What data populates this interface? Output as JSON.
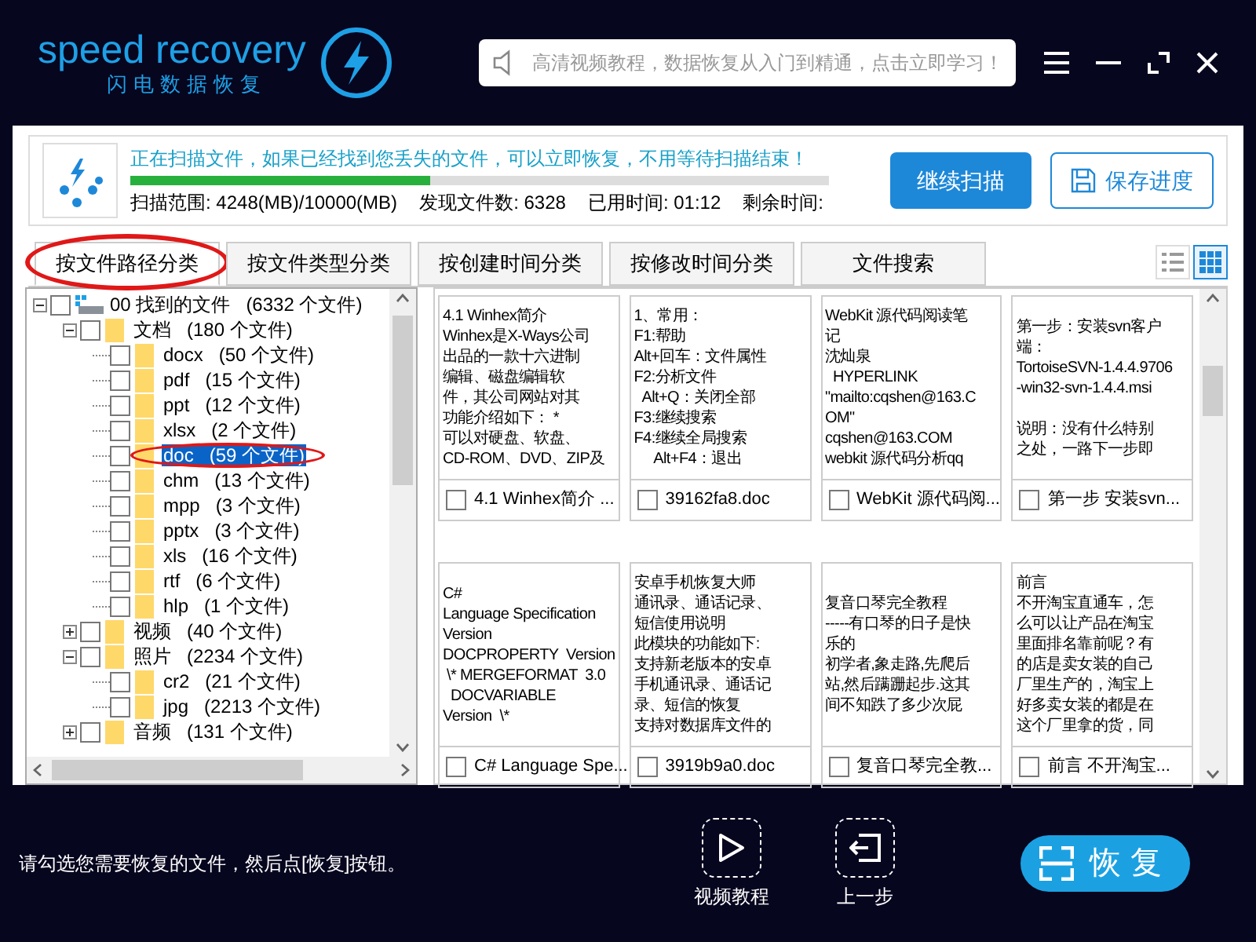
{
  "header": {
    "logo_text": "speed recovery",
    "logo_subtitle": "闪电数据恢复",
    "notice": "高清视频教程，数据恢复从入门到精通，点击立即学习！"
  },
  "scan": {
    "message": "正在扫描文件，如果已经找到您丢失的文件，可以立即恢复，不用等待扫描结束！",
    "level": 0.43,
    "range": "扫描范围: 4248(MB)/10000(MB)",
    "found": "发现文件数: 6328",
    "elapsed": "已用时间: 01:12",
    "remaining": "剩余时间:",
    "buttons": [
      {
        "label": "继续扫描",
        "kind": "primary"
      },
      {
        "label": "保存进度",
        "kind": "save"
      }
    ]
  },
  "tabs": [
    {
      "label": "按文件路径分类",
      "selected": true,
      "circled": true
    },
    {
      "label": "按文件类型分类",
      "selected": false,
      "circled": false
    },
    {
      "label": "按创建时间分类",
      "selected": false,
      "circled": false
    },
    {
      "label": "按修改时间分类",
      "selected": false,
      "circled": false
    },
    {
      "label": "文件搜索",
      "selected": false,
      "circled": false
    }
  ],
  "view_modes": [
    {
      "kind": "list",
      "selected": false
    },
    {
      "kind": "grid",
      "selected": true
    }
  ],
  "tree": [
    {
      "name": "00 找到的文件",
      "count": "(6332 个文件)",
      "kind": "drive",
      "expanded": true,
      "checked": false,
      "selected": false,
      "circled": false,
      "children": [
        {
          "name": "文档",
          "count": "(180 个文件)",
          "expanded": true,
          "checked": false,
          "selected": false,
          "circled": false,
          "children": [
            {
              "name": "docx",
              "count": "(50 个文件)",
              "checked": false,
              "selected": false,
              "circled": false
            },
            {
              "name": "pdf",
              "count": "(15 个文件)",
              "checked": false,
              "selected": false,
              "circled": false
            },
            {
              "name": "ppt",
              "count": "(12 个文件)",
              "checked": false,
              "selected": false,
              "circled": false
            },
            {
              "name": "xlsx",
              "count": "(2 个文件)",
              "checked": false,
              "selected": false,
              "circled": false
            },
            {
              "name": "doc",
              "count": "(59 个文件)",
              "checked": false,
              "selected": true,
              "circled": true
            },
            {
              "name": "chm",
              "count": "(13 个文件)",
              "checked": false,
              "selected": false,
              "circled": false
            },
            {
              "name": "mpp",
              "count": "(3 个文件)",
              "checked": false,
              "selected": false,
              "circled": false
            },
            {
              "name": "pptx",
              "count": "(3 个文件)",
              "checked": false,
              "selected": false,
              "circled": false
            },
            {
              "name": "xls",
              "count": "(16 个文件)",
              "checked": false,
              "selected": false,
              "circled": false
            },
            {
              "name": "rtf",
              "count": "(6 个文件)",
              "checked": false,
              "selected": false,
              "circled": false
            },
            {
              "name": "hlp",
              "count": "(1 个文件)",
              "checked": false,
              "selected": false,
              "circled": false
            }
          ]
        },
        {
          "name": "视频",
          "count": "(40 个文件)",
          "expanded": false,
          "checked": false,
          "selected": false,
          "circled": false
        },
        {
          "name": "照片",
          "count": "(2234 个文件)",
          "expanded": true,
          "checked": false,
          "selected": false,
          "circled": false,
          "children": [
            {
              "name": "cr2",
              "count": "(21 个文件)",
              "checked": false,
              "selected": false,
              "circled": false
            },
            {
              "name": "jpg",
              "count": "(2213 个文件)",
              "checked": false,
              "selected": false,
              "circled": false
            }
          ]
        },
        {
          "name": "音频",
          "count": "(131 个文件)",
          "expanded": false,
          "checked": false,
          "selected": false,
          "circled": false
        }
      ]
    }
  ],
  "files": [
    {
      "preview": [
        [
          "4.1 Winhex简介",
          "Winhex是X-Ways公司",
          "出品的一款十六进制",
          "编辑、磁盘编辑软",
          "件，其公司网站对其",
          "功能介绍如下： *",
          "可以对硬盘、软盘、",
          "CD-ROM、DVD、ZIP及"
        ]
      ],
      "caption": "4.1 Winhex简介 ...",
      "checked": false
    },
    {
      "preview": [
        [
          "1、常用：",
          "F1:帮助",
          "Alt+回车：文件属性",
          "F2:分析文件",
          "  Alt+Q：关闭全部",
          "F3:继续搜索",
          "F4:继续全局搜索",
          "     Alt+F4：退出"
        ]
      ],
      "caption": "39162fa8.doc",
      "checked": false
    },
    {
      "preview": [
        [
          "WebKit 源代码阅读笔",
          "记",
          "沈灿泉",
          "  HYPERLINK",
          "\"mailto:cqshen@163.C",
          "OM\"",
          "cqshen@163.COM",
          "webkit 源代码分析qq"
        ]
      ],
      "caption": "WebKit 源代码阅...",
      "checked": false
    },
    {
      "preview": [
        [
          "第一步：安装svn客户",
          "端：",
          "TortoiseSVN-1.4.4.9706",
          "-win32-svn-1.4.4.msi"
        ],
        [
          "说明：没有什么特别",
          "之处，一路下一步即"
        ]
      ],
      "caption": "第一步 安装svn...",
      "checked": false
    },
    {
      "preview": [
        [
          "C#",
          "Language Specification",
          "Version",
          "DOCPROPERTY  Version",
          " \\* MERGEFORMAT  3.0",
          "  DOCVARIABLE",
          "Version  \\*"
        ]
      ],
      "caption": "C# Language Spe...",
      "checked": false
    },
    {
      "preview": [
        [
          "安卓手机恢复大师",
          "通讯录、通话记录、",
          "短信使用说明",
          "此模块的功能如下:",
          "支持新老版本的安卓",
          "手机通讯录、通话记",
          "录、短信的恢复",
          "支持对数据库文件的"
        ]
      ],
      "caption": "3919b9a0.doc",
      "checked": false
    },
    {
      "preview": [
        [
          "复音口琴完全教程",
          "-----有口琴的日子是快",
          "乐的",
          "初学者,象走路,先爬后",
          "站,然后蹒跚起步.这其",
          "间不知跌了多少次屁"
        ]
      ],
      "caption": "复音口琴完全教...",
      "checked": false
    },
    {
      "preview": [
        [
          "前言",
          "不开淘宝直通车，怎",
          "么可以让产品在淘宝",
          "里面排名靠前呢？有",
          "的店是卖女装的自己",
          "厂里生产的，淘宝上",
          "好多卖女装的都是在",
          "这个厂里拿的货，同"
        ]
      ],
      "caption": "前言 不开淘宝...",
      "checked": false
    }
  ],
  "footer": {
    "hint": "请勾选您需要恢复的文件，然后点[恢复]按钮。",
    "actions": [
      {
        "label": "视频教程",
        "kind": "play"
      },
      {
        "label": "上一步",
        "kind": "back"
      }
    ],
    "recover": "恢复"
  }
}
